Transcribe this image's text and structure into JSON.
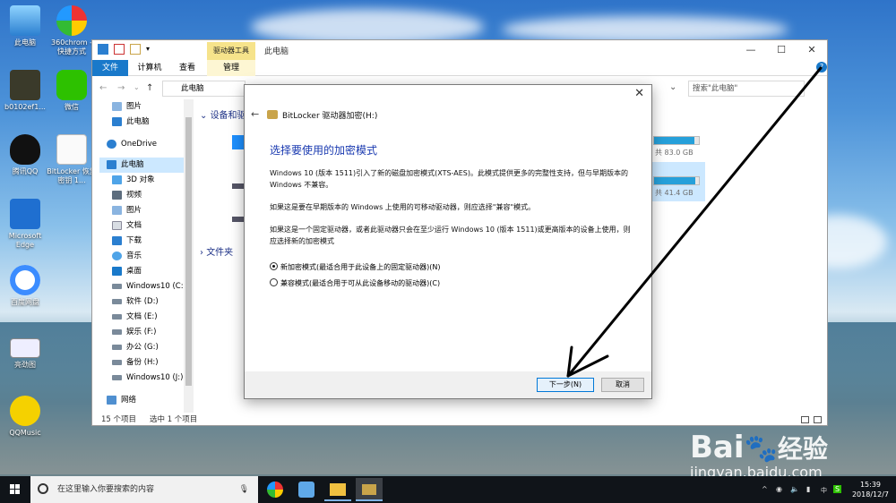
{
  "desktop": {
    "icons": [
      {
        "label": "此电脑"
      },
      {
        "label": "360chrom - 快捷方式"
      },
      {
        "label": "b0102ef1..."
      },
      {
        "label": "微信"
      },
      {
        "label": "腾讯QQ"
      },
      {
        "label": "BitLocker 恢复密钥 1..."
      },
      {
        "label": "Microsoft Edge"
      },
      {
        "label": "百度网盘"
      },
      {
        "label": "亮劲图"
      },
      {
        "label": "QQMusic"
      }
    ]
  },
  "explorer": {
    "ribbon": {
      "context_tab": "驱动器工具",
      "window_title": "此电脑",
      "tabs": [
        "文件",
        "计算机",
        "查看",
        "管理"
      ]
    },
    "address": "此电脑",
    "search_placeholder": "搜索\"此电脑\"",
    "sidebar": [
      {
        "label": "图片",
        "icon": "picture-icon"
      },
      {
        "label": "此电脑",
        "icon": "computer-icon"
      },
      {
        "label": "OneDrive",
        "icon": "cloud-icon"
      },
      {
        "label": "此电脑",
        "icon": "computer-icon"
      },
      {
        "label": "3D 对象",
        "icon": "cube-icon"
      },
      {
        "label": "视频",
        "icon": "video-icon"
      },
      {
        "label": "图片",
        "icon": "picture-icon"
      },
      {
        "label": "文档",
        "icon": "document-icon"
      },
      {
        "label": "下载",
        "icon": "download-icon"
      },
      {
        "label": "音乐",
        "icon": "music-icon"
      },
      {
        "label": "桌面",
        "icon": "desktop-icon"
      },
      {
        "label": "Windows10 (C:",
        "icon": "drive-icon"
      },
      {
        "label": "软件 (D:)",
        "icon": "drive-icon"
      },
      {
        "label": "文档 (E:)",
        "icon": "drive-icon"
      },
      {
        "label": "娱乐 (F:)",
        "icon": "drive-icon"
      },
      {
        "label": "办公 (G:)",
        "icon": "drive-icon"
      },
      {
        "label": "备份 (H:)",
        "icon": "drive-icon"
      },
      {
        "label": "Windows10 (J:)",
        "icon": "drive-icon"
      },
      {
        "label": "网络",
        "icon": "network-icon"
      }
    ],
    "sections": {
      "devices": "设备和驱",
      "folders": "文件夹"
    },
    "drives": [
      {
        "free_text": "共 83.0 GB",
        "used_fraction": 0.9
      },
      {
        "free_text": "共 41.4 GB",
        "used_fraction": 0.92
      }
    ],
    "status": {
      "count": "15 个项目",
      "selected": "选中 1 个项目"
    }
  },
  "dialog": {
    "title": "BitLocker 驱动器加密(H:)",
    "heading": "选择要使用的加密模式",
    "paragraph1": "Windows 10 (版本 1511)引入了新的磁盘加密模式(XTS-AES)。此模式提供更多的完整性支持，但与早期版本的 Windows 不兼容。",
    "paragraph2": "如果这是要在早期版本的 Windows 上使用的可移动驱动器，则应选择\"兼容\"模式。",
    "paragraph3": "如果这是一个固定驱动器，或者此驱动器只会在至少运行 Windows 10 (版本 1511)或更高版本的设备上使用，则应选择新的加密模式",
    "options": [
      {
        "label": "新加密模式(最适合用于此设备上的固定驱动器)(N)",
        "selected": true
      },
      {
        "label": "兼容模式(最适合用于可从此设备移动的驱动器)(C)",
        "selected": false
      }
    ],
    "next_button": "下一步(N)",
    "cancel_button": "取消"
  },
  "taskbar": {
    "search_placeholder": "在这里输入你要搜索的内容",
    "time": "15:39",
    "date": "2018/12/7"
  },
  "watermark": {
    "brand": "Bai",
    "brand_cn": "经验",
    "url": "jingyan.baidu.com"
  }
}
